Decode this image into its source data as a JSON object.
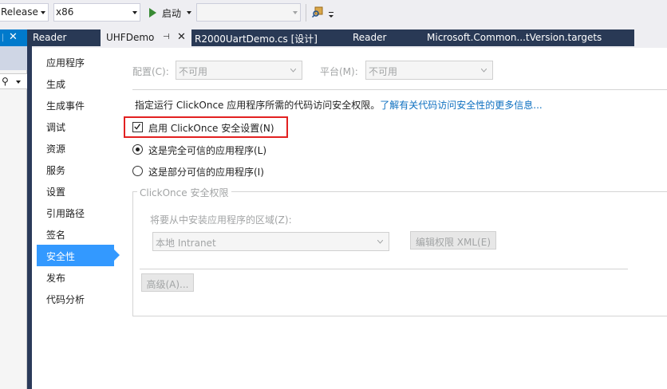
{
  "toolbar": {
    "configuration": "Release",
    "platform": "x86",
    "start_label": "启动",
    "target_value": ""
  },
  "left_pane": {
    "search_icon": "search-icon"
  },
  "tabs": [
    {
      "label": "Reader",
      "active": false
    },
    {
      "label": "UHFDemo",
      "active": true
    },
    {
      "label": "R2000UartDemo.cs [设计]",
      "active": false
    },
    {
      "label": "Reader",
      "active": false
    },
    {
      "label": "Microsoft.Common...tVersion.targets",
      "active": false
    }
  ],
  "nav": {
    "items": [
      "应用程序",
      "生成",
      "生成事件",
      "调试",
      "资源",
      "服务",
      "设置",
      "引用路径",
      "签名",
      "安全性",
      "发布",
      "代码分析"
    ],
    "selected_index": 9
  },
  "config": {
    "configuration_label": "配置(C):",
    "configuration_value": "不可用",
    "platform_label": "平台(M):",
    "platform_value": "不可用"
  },
  "security": {
    "description": "指定运行 ClickOnce 应用程序所需的代码访问安全权限。",
    "learn_more_link": "了解有关代码访问安全性的更多信息...",
    "enable_checkbox_label": "启用 ClickOnce 安全设置(N)",
    "enable_checked": true,
    "full_trust_label": "这是完全可信的应用程序(L)",
    "partial_trust_label": "这是部分可信的应用程序(I)",
    "full_trust_selected": true,
    "permissions_group_label": "ClickOnce 安全权限",
    "zone_label": "将要从中安装应用程序的区域(Z):",
    "zone_value": "本地 Intranet",
    "edit_xml_button": "编辑权限 XML(E)",
    "advanced_button": "高级(A)..."
  },
  "colors": {
    "accent": "#3399ff",
    "tab_bar": "#293955",
    "highlight": "#e22121",
    "link": "#0e70c0"
  }
}
